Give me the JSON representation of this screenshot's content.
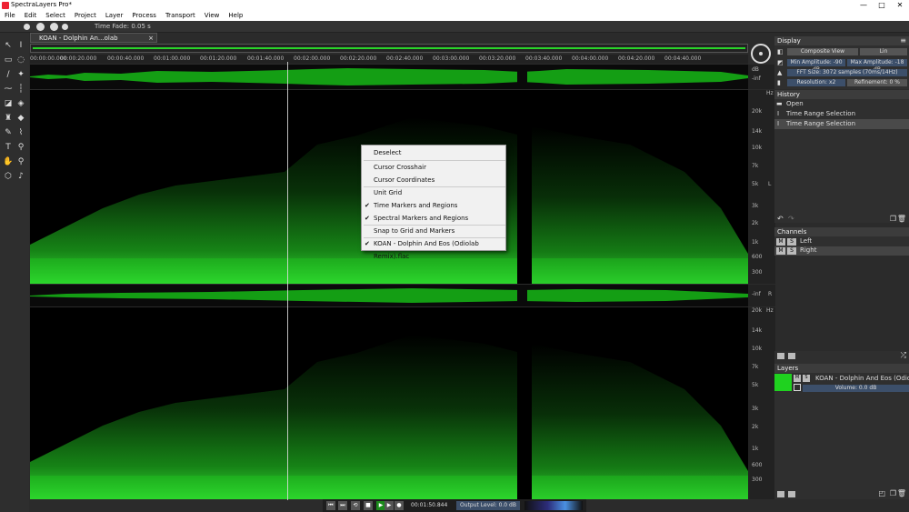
{
  "window": {
    "title": "SpectraLayers Pro*",
    "minimize": "—",
    "maximize": "□",
    "close": "✕"
  },
  "menu": [
    "File",
    "Edit",
    "Select",
    "Project",
    "Layer",
    "Process",
    "Transport",
    "View",
    "Help"
  ],
  "toolbar": {
    "time_fade": "Time Fade: 0.05 s"
  },
  "document_tab": {
    "label": "KOAN - Dolphin An...olab Remix).flac*",
    "close": "×"
  },
  "ruler": [
    "00:00:00.000",
    "00:00:20.000",
    "00:00:40.000",
    "00:01:00.000",
    "00:01:20.000",
    "00:01:40.000",
    "00:02:00.000",
    "00:02:20.000",
    "00:02:40.000",
    "00:03:00.000",
    "00:03:20.000",
    "00:03:40.000",
    "00:04:00.000",
    "00:04:20.000",
    "00:04:40.000"
  ],
  "waveform_axis": {
    "db": "dB",
    "inf": "-inf"
  },
  "freq_axis": {
    "unit": "Hz",
    "labels": [
      "20k",
      "14k",
      "10k",
      "7k",
      "5k",
      "3k",
      "2k",
      "1k",
      "600",
      "300"
    ]
  },
  "channel_marks": {
    "left": "L",
    "right": "R"
  },
  "display_panel": {
    "title": "Display",
    "composite_view": "Composite View",
    "lin": "Lin",
    "min_amp": "Min Amplitude: -90 dB",
    "max_amp": "Max Amplitude: -18 dB",
    "fft": "FFT Size: 3072 samples (70ms/14Hz)",
    "resolution": "Resolution: x2",
    "refinement": "Refinement: 0 %"
  },
  "history_panel": {
    "title": "History",
    "items": [
      "Open",
      "Time Range Selection",
      "Time Range Selection"
    ]
  },
  "channels_panel": {
    "title": "Channels",
    "items": [
      {
        "m": "M",
        "s": "S",
        "name": "Left"
      },
      {
        "m": "M",
        "s": "S",
        "name": "Right"
      }
    ]
  },
  "layers_panel": {
    "title": "Layers",
    "layer_name": "KOAN - Dolphin And Eos (Odiolab Re",
    "volume": "Volume: 0.0 dB",
    "m": "M",
    "s": "S"
  },
  "context_menu": {
    "items": [
      {
        "label": "Deselect",
        "checked": false
      },
      {
        "label": "Cursor Crosshair",
        "checked": false
      },
      {
        "label": "Cursor Coordinates",
        "checked": false
      },
      {
        "label": "Unit Grid",
        "checked": false
      },
      {
        "label": "Time Markers and Regions",
        "checked": true
      },
      {
        "label": "Spectral Markers and Regions",
        "checked": true
      },
      {
        "label": "Snap to Grid and Markers",
        "checked": false
      },
      {
        "label": "KOAN - Dolphin And Eos (Odiolab Remix).flac",
        "checked": true
      }
    ],
    "checkmark": "✔"
  },
  "transport": {
    "time": "00:01:50.844",
    "output_level": "Output Level: 0.0 dB",
    "buttons": [
      "⏮",
      "⏭",
      "⟲",
      "■",
      "▶",
      "▶",
      "●"
    ]
  },
  "colors": {
    "spectrum": "#1fd21f",
    "accent": "#2ad42a"
  }
}
